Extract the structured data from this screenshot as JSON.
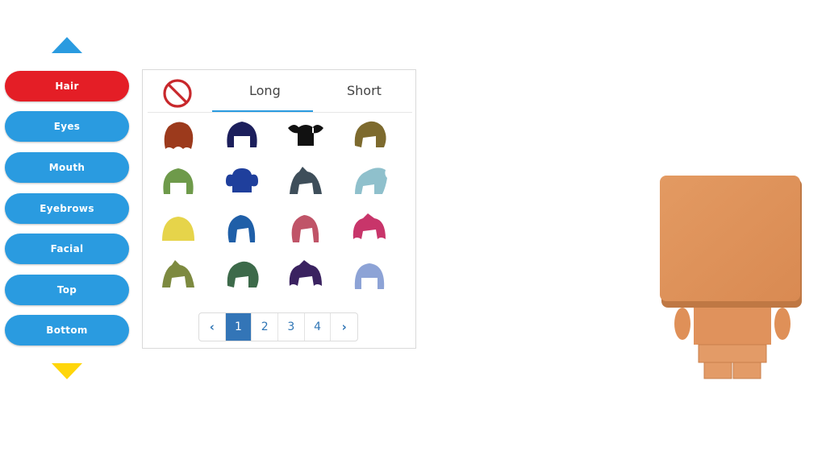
{
  "nav": {
    "up_arrow_icon": "triangle-up",
    "down_arrow_icon": "triangle-down",
    "categories": [
      {
        "label": "Hair",
        "active": true
      },
      {
        "label": "Eyes",
        "active": false
      },
      {
        "label": "Mouth",
        "active": false
      },
      {
        "label": "Eyebrows",
        "active": false
      },
      {
        "label": "Facial",
        "active": false
      },
      {
        "label": "Top",
        "active": false
      },
      {
        "label": "Bottom",
        "active": false
      }
    ],
    "colors": {
      "active": "#e41e26",
      "inactive": "#2a9be0",
      "up_arrow": "#2a9be0",
      "down_arrow": "#ffd60a"
    }
  },
  "panel": {
    "none_icon": "prohibited-icon",
    "tabs": [
      {
        "label": "Long",
        "active": true
      },
      {
        "label": "Short",
        "active": false
      }
    ],
    "hair_items": [
      {
        "style": "curly",
        "color": "#9c3a1c"
      },
      {
        "style": "bob",
        "color": "#1c1f5c"
      },
      {
        "style": "pigtails",
        "color": "#111111"
      },
      {
        "style": "messy",
        "color": "#7d6a2e"
      },
      {
        "style": "bob",
        "color": "#6e9a4a"
      },
      {
        "style": "buns",
        "color": "#1f3f9c"
      },
      {
        "style": "spiky",
        "color": "#3e4e5a"
      },
      {
        "style": "side",
        "color": "#8fc0cc"
      },
      {
        "style": "straight",
        "color": "#e6d44a"
      },
      {
        "style": "long",
        "color": "#1f5fa8"
      },
      {
        "style": "long",
        "color": "#c05468"
      },
      {
        "style": "wavy",
        "color": "#c8356a"
      },
      {
        "style": "spiky",
        "color": "#7d8a40"
      },
      {
        "style": "messy",
        "color": "#3d6a4a"
      },
      {
        "style": "wavy",
        "color": "#3a2260"
      },
      {
        "style": "helmet",
        "color": "#8da3d6"
      }
    ],
    "pagination": {
      "prev_icon": "chevron-left",
      "next_icon": "chevron-right",
      "prev_glyph": "‹",
      "next_glyph": "›",
      "pages": [
        "1",
        "2",
        "3",
        "4"
      ],
      "current": "1"
    }
  },
  "character": {
    "skin_color": "#e0925c"
  }
}
